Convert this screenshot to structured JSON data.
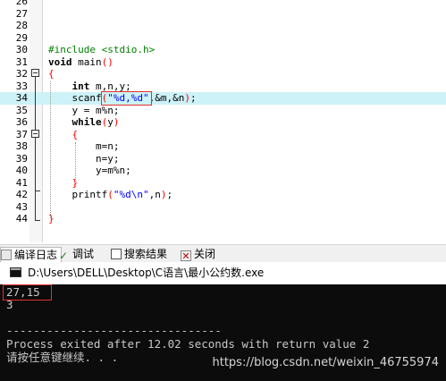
{
  "editor": {
    "lines": [
      {
        "num": "26",
        "code": ""
      },
      {
        "num": "27",
        "code": ""
      },
      {
        "num": "28",
        "code": ""
      },
      {
        "num": "29",
        "code": ""
      },
      {
        "num": "30",
        "code": "#include <stdio.h>"
      },
      {
        "num": "31",
        "code": "void main()"
      },
      {
        "num": "32",
        "code": "{"
      },
      {
        "num": "33",
        "code": "    int m,n,y;"
      },
      {
        "num": "34",
        "code": "    scanf(\"%d,%d\",&m,&n);"
      },
      {
        "num": "35",
        "code": "    y = m%n;"
      },
      {
        "num": "36",
        "code": "    while(y)"
      },
      {
        "num": "37",
        "code": "    {"
      },
      {
        "num": "38",
        "code": "        m=n;"
      },
      {
        "num": "39",
        "code": "        n=y;"
      },
      {
        "num": "40",
        "code": "        y=m%n;"
      },
      {
        "num": "41",
        "code": "    }"
      },
      {
        "num": "42",
        "code": "    printf(\"%d\\n\",n);"
      },
      {
        "num": "43",
        "code": ""
      },
      {
        "num": "44",
        "code": "}"
      }
    ],
    "highlighted_line": "34"
  },
  "tabs": [
    {
      "label": "编译日志",
      "icon": "compile-log-icon"
    },
    {
      "label": "调试",
      "icon": "debug-check-icon"
    },
    {
      "label": "搜索结果",
      "icon": "search-results-icon"
    },
    {
      "label": "关闭",
      "icon": "close-icon"
    }
  ],
  "console": {
    "title": "D:\\Users\\DELL\\Desktop\\C语言\\最小公约数.exe",
    "lines": [
      "27,15",
      "3",
      "",
      "--------------------------------",
      "Process exited after 12.02 seconds with return value 2",
      "请按任意键继续. . ."
    ],
    "watermark": "https://blog.csdn.net/weixin_46755974"
  },
  "colors": {
    "keyword": "#000000",
    "preprocessor": "#008000",
    "string": "#0000ff",
    "brace": "#ff0000",
    "line_highlight": "#cdf2f7",
    "annotation_box": "#e5302b",
    "console_bg": "#0c0c0c",
    "console_text": "#c8c8c8"
  }
}
